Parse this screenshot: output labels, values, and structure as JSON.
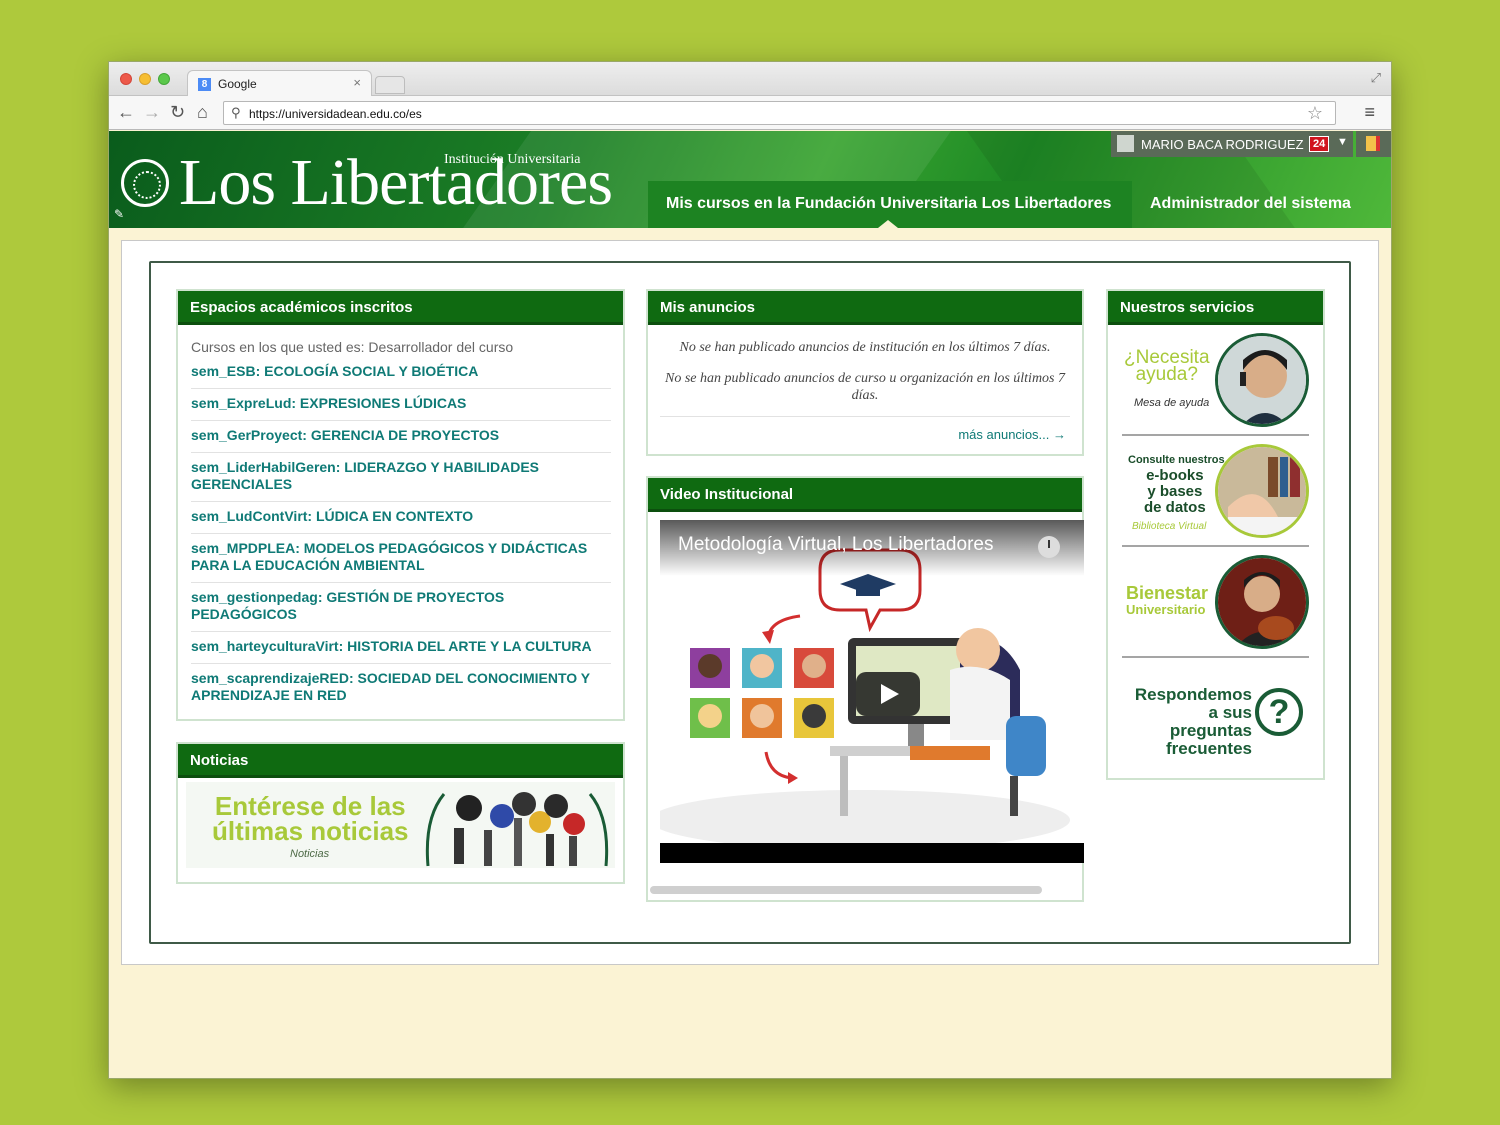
{
  "browser": {
    "tab_title": "Google",
    "tab_favicon": "8",
    "tab_close": "×",
    "url": "https://universidadean.edu.co/es",
    "icons": {
      "back": "←",
      "forward": "→",
      "reload": "↻",
      "home": "⌂",
      "search": "⚲",
      "star": "☆",
      "menu": "≡",
      "fullscreen": "⤢"
    }
  },
  "header": {
    "brand_subtitle": "Institución Universitaria",
    "brand_title": "Los Libertadores",
    "user_name": "MARIO BACA RODRIGUEZ",
    "notification_count": "24",
    "tabs": [
      {
        "label": "Mis cursos en la Fundación Universitaria Los Libertadores",
        "active": true
      },
      {
        "label": "Administrador del sistema",
        "active": false
      }
    ],
    "colors": {
      "primary": "#0f6a11",
      "accent": "#a8c93a",
      "link": "#0f7a76"
    }
  },
  "espacios": {
    "title": "Espacios académicos inscritos",
    "intro": "Cursos en los que usted es: Desarrollador del curso",
    "courses": [
      "sem_ESB: ECOLOGÍA SOCIAL Y BIOÉTICA",
      "sem_ExpreLud: EXPRESIONES LÚDICAS",
      "sem_GerProyect: GERENCIA DE PROYECTOS",
      "sem_LiderHabilGeren: LIDERAZGO Y HABILIDADES GERENCIALES",
      "sem_LudContVirt: LÚDICA EN CONTEXTO",
      "sem_MPDPLEA: MODELOS PEDAGÓGICOS Y DIDÁCTICAS PARA LA EDUCACIÓN AMBIENTAL",
      "sem_gestionpedag: GESTIÓN DE PROYECTOS PEDAGÓGICOS",
      "sem_harteyculturaVirt: HISTORIA DEL ARTE Y LA CULTURA",
      "sem_scaprendizajeRED: SOCIEDAD DEL CONOCIMIENTO Y APRENDIZAJE EN RED"
    ]
  },
  "noticias": {
    "title": "Noticias",
    "banner_line1": "Entérese de las",
    "banner_line2": "últimas noticias",
    "banner_sub": "Noticias"
  },
  "anuncios": {
    "title": "Mis anuncios",
    "msg_institution": "No se han publicado anuncios de institución en los últimos 7 días.",
    "msg_course": "No se han publicado anuncios de curso u organización en los últimos 7 días.",
    "more_link": "más anuncios... →"
  },
  "video": {
    "title": "Video Institucional",
    "video_title": "Metodología Virtual, Los Libertadores"
  },
  "servicios": {
    "title": "Nuestros servicios",
    "help_line1": "¿Necesita",
    "help_line2": "ayuda?",
    "help_sub": "Mesa de ayuda",
    "ebooks_pre": "Consulte nuestros",
    "ebooks_line1": "e-books",
    "ebooks_line2": "y bases",
    "ebooks_line3": "de datos",
    "ebooks_sub": "Biblioteca Virtual",
    "bienestar_line1": "Bienestar",
    "bienestar_line2": "Universitario",
    "faq_line1": "Respondemos",
    "faq_line2": "a sus preguntas",
    "faq_line3": "frecuentes",
    "faq_icon": "?"
  }
}
